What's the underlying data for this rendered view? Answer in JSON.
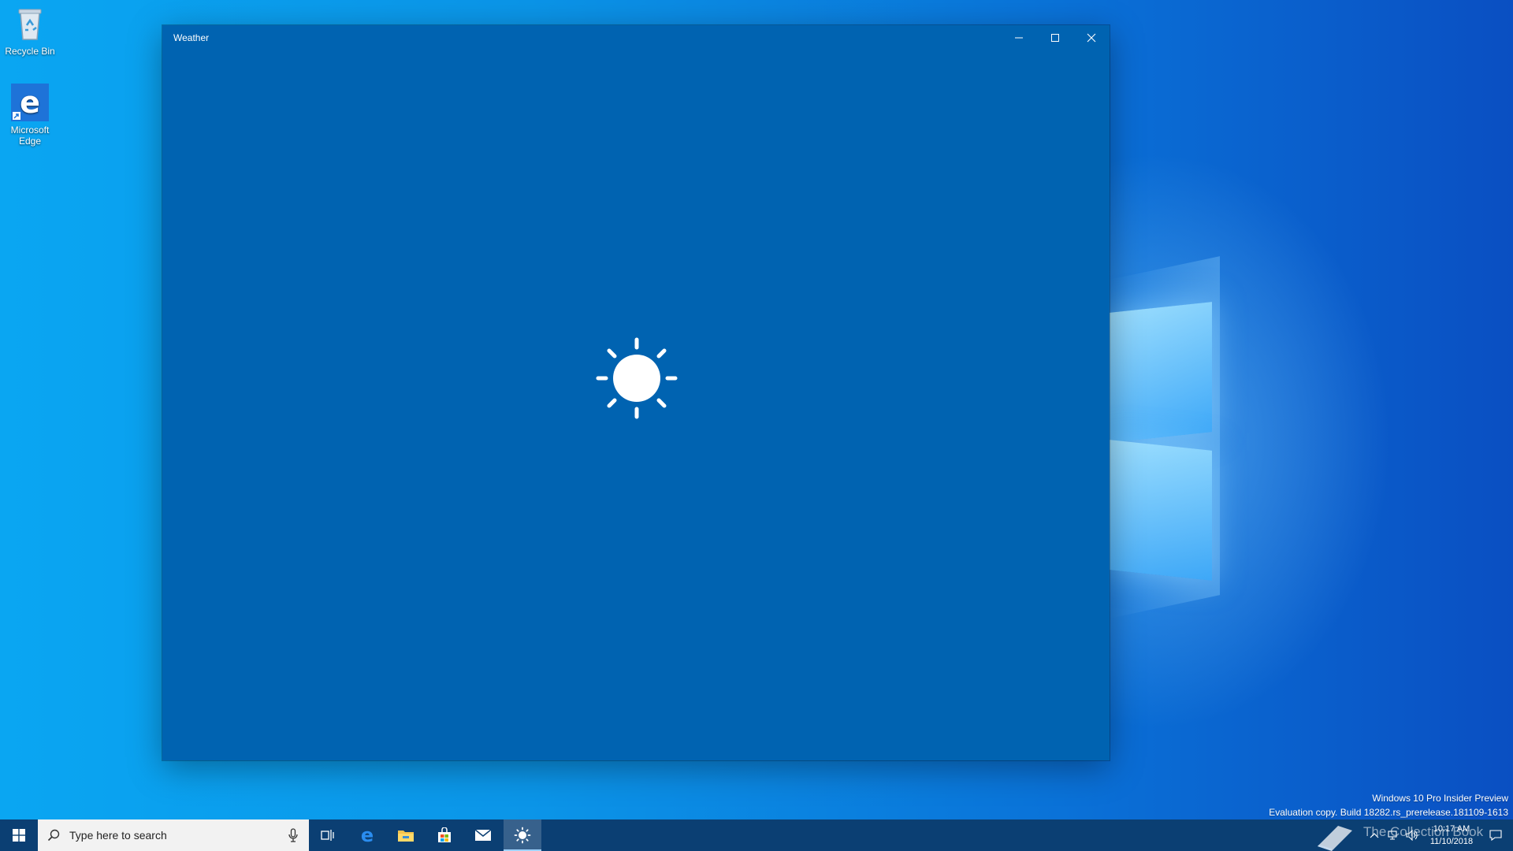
{
  "desktop": {
    "icons": [
      {
        "label": "Recycle Bin",
        "icon": "recycle-bin-icon"
      },
      {
        "label": "Microsoft Edge",
        "icon": "edge-icon"
      }
    ],
    "watermark_line1": "Windows 10 Pro Insider Preview",
    "watermark_line2": "Evaluation copy. Build 18282.rs_prerelease.181109-1613",
    "watermark_logo_text": "The Collection Book"
  },
  "window": {
    "title": "Weather",
    "background": "#0063b1",
    "splash_icon": "sun-icon"
  },
  "taskbar": {
    "search_placeholder": "Type here to search",
    "pinned": [
      "task-view-icon",
      "edge-icon",
      "file-explorer-icon",
      "store-icon",
      "mail-icon",
      "weather-icon"
    ],
    "active_app": "Weather",
    "time": "10:17 AM",
    "date": "11/10/2018"
  }
}
